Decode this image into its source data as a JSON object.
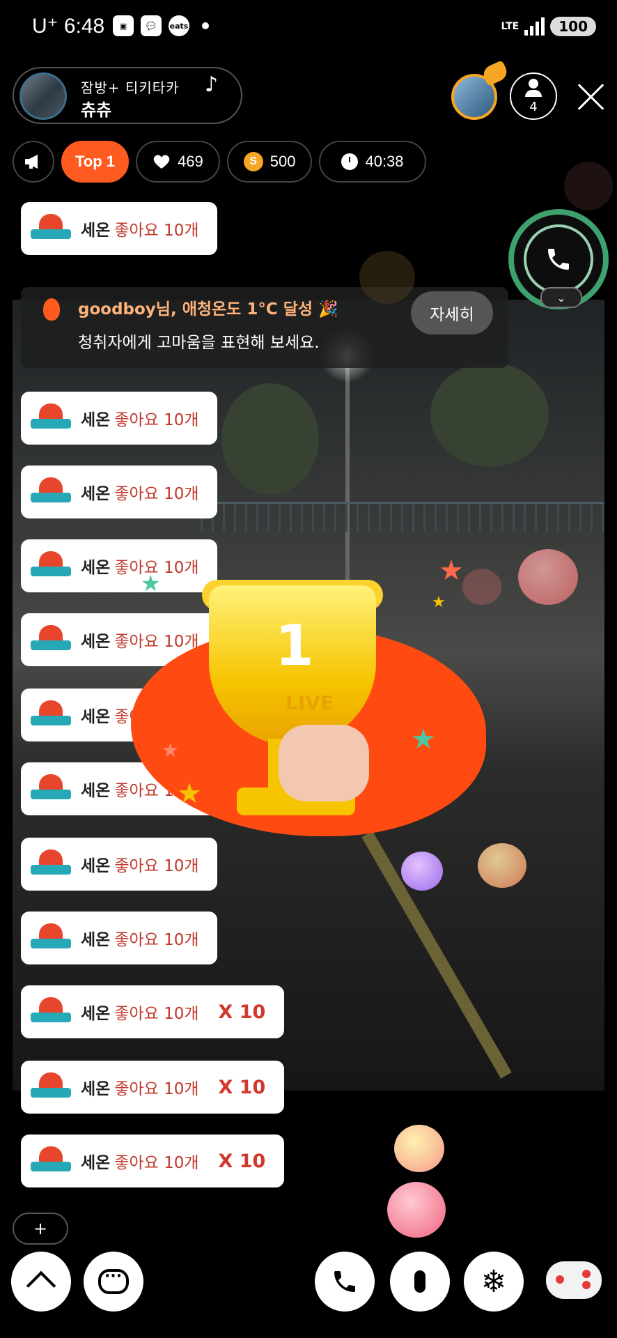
{
  "status_bar": {
    "carrier": "U⁺ 6:48",
    "icons": [
      "screenshot-icon",
      "messages-icon",
      "coupang-eats-icon"
    ],
    "network": "LTE",
    "battery": "100"
  },
  "host": {
    "title": "잠방+ 티키타카",
    "note": "♪",
    "name": "츄츄"
  },
  "viewers": {
    "count": "4"
  },
  "stats": {
    "rank": "Top 1",
    "likes": "469",
    "coin_symbol": "S",
    "coins": "500",
    "duration": "40:38"
  },
  "notice": {
    "line1": "goodboy님, 애청온도 1°C 달성 🎉",
    "line2": "청취자에게 고마움을 표현해 보세요.",
    "detail_label": "자세히"
  },
  "chat": {
    "messages": [
      {
        "nick": "세온",
        "text": "좋아요 10개",
        "multiplier": ""
      },
      {
        "nick": "세온",
        "text": "좋아요 10개",
        "multiplier": ""
      },
      {
        "nick": "세온",
        "text": "좋아요 10개",
        "multiplier": ""
      },
      {
        "nick": "세온",
        "text": "좋아요 10개",
        "multiplier": ""
      },
      {
        "nick": "세온",
        "text": "좋아요 10개",
        "multiplier": ""
      },
      {
        "nick": "세온",
        "text": "좋아요 10개",
        "multiplier": ""
      },
      {
        "nick": "세온",
        "text": "좋아요 10개",
        "multiplier": ""
      },
      {
        "nick": "세온",
        "text": "좋아요 10개",
        "multiplier": ""
      },
      {
        "nick": "세온",
        "text": "좋아요 10개",
        "multiplier": ""
      },
      {
        "nick": "세온",
        "text": "좋아요 10개",
        "multiplier": "X 10"
      },
      {
        "nick": "세온",
        "text": "좋아요 10개",
        "multiplier": "X 10"
      },
      {
        "nick": "세온",
        "text": "좋아요 10개",
        "multiplier": "X 10"
      }
    ]
  },
  "trophy": {
    "number": "1",
    "label": "LIVE"
  },
  "controls": {
    "plus_label": "+"
  }
}
